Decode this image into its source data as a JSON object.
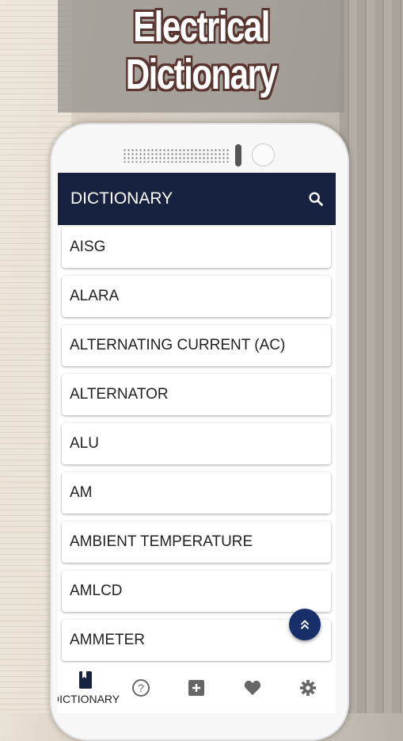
{
  "promo": {
    "title_line1": "Electrical",
    "title_line2": "Dictionary"
  },
  "app_bar": {
    "title": "DICTIONARY",
    "search_icon": "search-icon"
  },
  "colors": {
    "app_bar": "#16223f",
    "fab": "#17306a",
    "nav_active": "#16223f",
    "nav_inactive": "#666666"
  },
  "list": {
    "items": [
      "AISG",
      "ALARA",
      "ALTERNATING CURRENT (AC)",
      "ALTERNATOR",
      "ALU",
      "AM",
      "AMBIENT TEMPERATURE",
      "AMLCD",
      "AMMETER"
    ]
  },
  "fab": {
    "icon": "double-chevron-up-icon"
  },
  "bottom_nav": {
    "items": [
      {
        "label": "DICTIONARY",
        "icon": "book-icon",
        "active": true
      },
      {
        "icon": "help-icon"
      },
      {
        "icon": "add-box-icon"
      },
      {
        "icon": "heart-icon"
      },
      {
        "icon": "gear-icon"
      }
    ]
  }
}
